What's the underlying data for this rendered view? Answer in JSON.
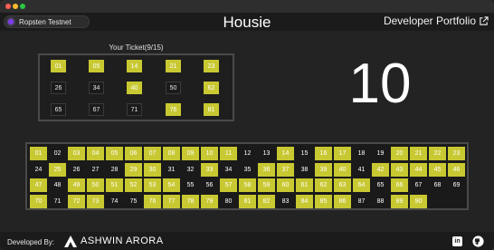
{
  "window": {
    "traffic_lights": [
      "close",
      "minimize",
      "maximize"
    ]
  },
  "header": {
    "network_label": "Ropsten Testnet",
    "title": "Housie",
    "portfolio_label": "Developer Portfolio"
  },
  "ticket": {
    "title": "Your Ticket(9/15)",
    "rows": [
      [
        {
          "n": "01",
          "m": true
        },
        {
          "n": "05",
          "m": true
        },
        {
          "n": "14",
          "m": true
        },
        {
          "n": "21",
          "m": true
        },
        {
          "n": "23",
          "m": true
        }
      ],
      [
        {
          "n": "26",
          "m": false
        },
        {
          "n": "34",
          "m": false
        },
        {
          "n": "40",
          "m": true
        },
        {
          "n": "50",
          "m": false
        },
        {
          "n": "62",
          "m": true
        }
      ],
      [
        {
          "n": "65",
          "m": false
        },
        {
          "n": "67",
          "m": false
        },
        {
          "n": "71",
          "m": false
        },
        {
          "n": "76",
          "m": true
        },
        {
          "n": "81",
          "m": true
        }
      ]
    ]
  },
  "current_number": "10",
  "board": {
    "called": [
      "01",
      "03",
      "04",
      "05",
      "06",
      "07",
      "08",
      "09",
      "10",
      "11",
      "14",
      "16",
      "17",
      "20",
      "21",
      "22",
      "23",
      "25",
      "29",
      "30",
      "33",
      "36",
      "37",
      "39",
      "40",
      "42",
      "43",
      "44",
      "45",
      "46",
      "47",
      "49",
      "50",
      "51",
      "52",
      "53",
      "54",
      "57",
      "58",
      "59",
      "60",
      "61",
      "62",
      "63",
      "64",
      "66",
      "70",
      "72",
      "73",
      "76",
      "77",
      "78",
      "79",
      "81",
      "82",
      "84",
      "85",
      "86",
      "89",
      "90"
    ]
  },
  "footer": {
    "developed_by": "Developed By:",
    "author": "ASHWIN ARORA"
  },
  "colors": {
    "marked": "#c8c832",
    "background": "#232323"
  }
}
